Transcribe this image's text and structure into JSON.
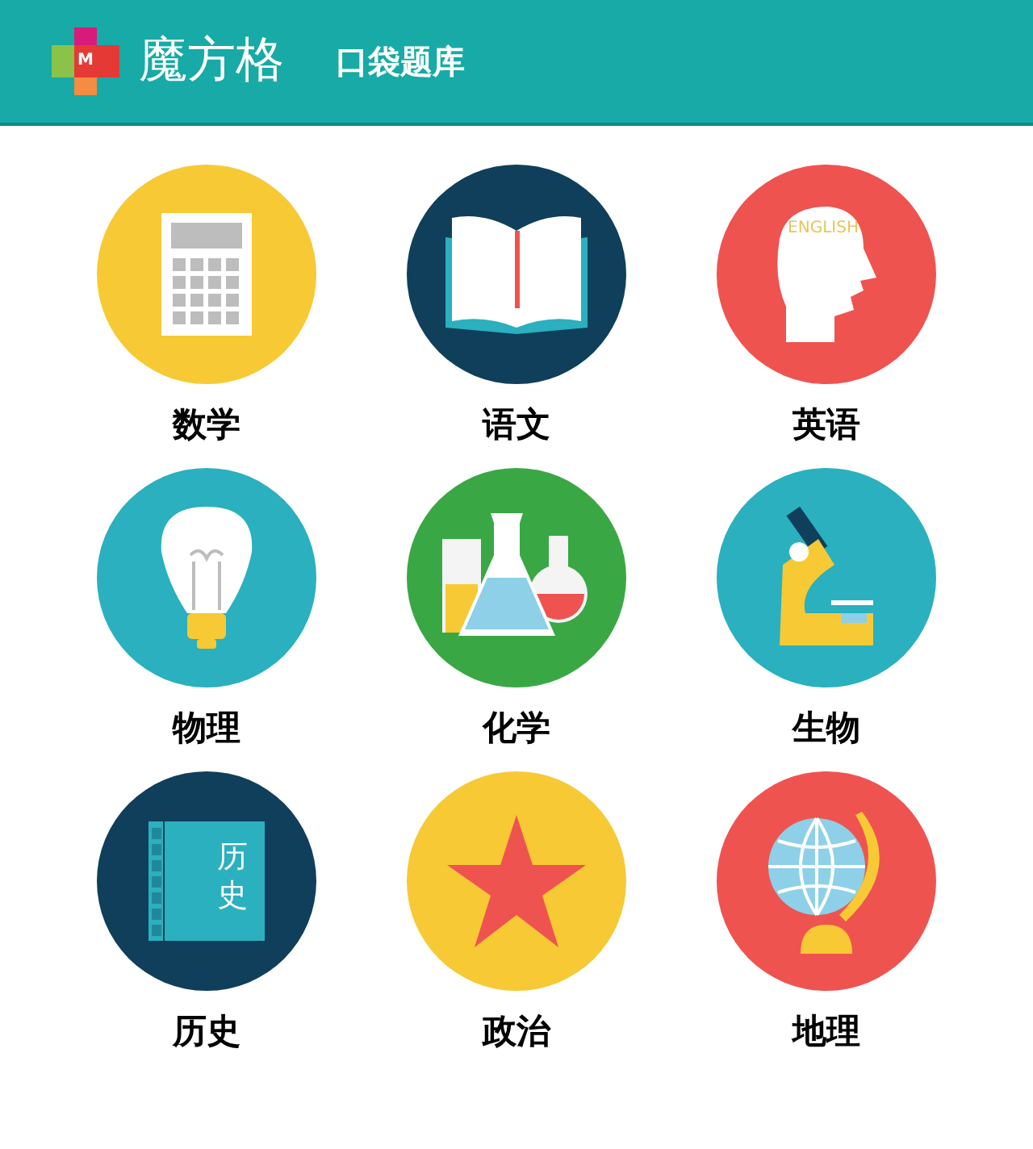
{
  "header": {
    "logo_letter": "M",
    "brand": "魔方格",
    "title": "口袋题库"
  },
  "subjects": [
    {
      "label": "数学",
      "kind": "calculator",
      "color": "#f7c935"
    },
    {
      "label": "语文",
      "kind": "book",
      "color": "#0f3f5a"
    },
    {
      "label": "英语",
      "kind": "head",
      "color": "#ef5350",
      "icon_text": "ENGLISH"
    },
    {
      "label": "物理",
      "kind": "bulb",
      "color": "#2ab0bf"
    },
    {
      "label": "化学",
      "kind": "flasks",
      "color": "#3aa745"
    },
    {
      "label": "生物",
      "kind": "microscope",
      "color": "#2ab0bf"
    },
    {
      "label": "历史",
      "kind": "textbook",
      "color": "#0f3f5a",
      "icon_text": "历史"
    },
    {
      "label": "政治",
      "kind": "star",
      "color": "#f7c935"
    },
    {
      "label": "地理",
      "kind": "globe",
      "color": "#ef5350"
    }
  ]
}
